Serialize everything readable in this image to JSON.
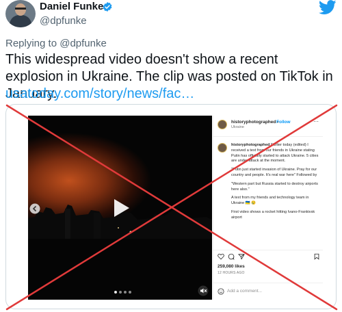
{
  "tweet": {
    "author": {
      "display_name": "Daniel Funke",
      "handle": "@dpfunke",
      "verified": true
    },
    "reply_prefix": "Replying to",
    "reply_to": "@dpfunke",
    "text": "This widespread video doesn't show a recent explosion in Ukraine. The clip was posted on TikTok in January.",
    "link": "usatoday.com/story/news/fac…",
    "accent_color": "#1d9bf0"
  },
  "instagram_post": {
    "username": "historyphotographed",
    "follow_separator": "•",
    "follow_label": "Follow",
    "location": "Ukraine",
    "more_label": "···",
    "caption_user": "historyphotographed",
    "caption_paragraphs": [
      "Earlier today (edited) I received a text from our friends in Ukraine stating Putin has officially started to attack Ukraine. 5 cities are under attack at the moment.",
      "\"Putin just started invasion of Ukraine. Pray for our country and people. It's real war here\" Followed by",
      "\"Western part but Russia started to destroy airports here also.\"",
      "A text from my friends and technology team in Ukraine 🇺🇦 😢",
      "First video shows a rocket hitting Ivano-Frankivsk airport"
    ],
    "likes": "259,080 likes",
    "timestamp": "12 HOURS AGO",
    "comment_placeholder": "Add a comment...",
    "carousel_pages": 4,
    "carousel_active_index": 0
  },
  "icons": [
    "verified-icon",
    "twitter-bird-icon",
    "play-icon",
    "chevron-left-icon",
    "speaker-muted-icon",
    "heart-icon",
    "comment-icon",
    "share-icon",
    "bookmark-icon",
    "smiley-icon"
  ],
  "overlay": {
    "type": "red-x",
    "color": "#e03a3a"
  }
}
